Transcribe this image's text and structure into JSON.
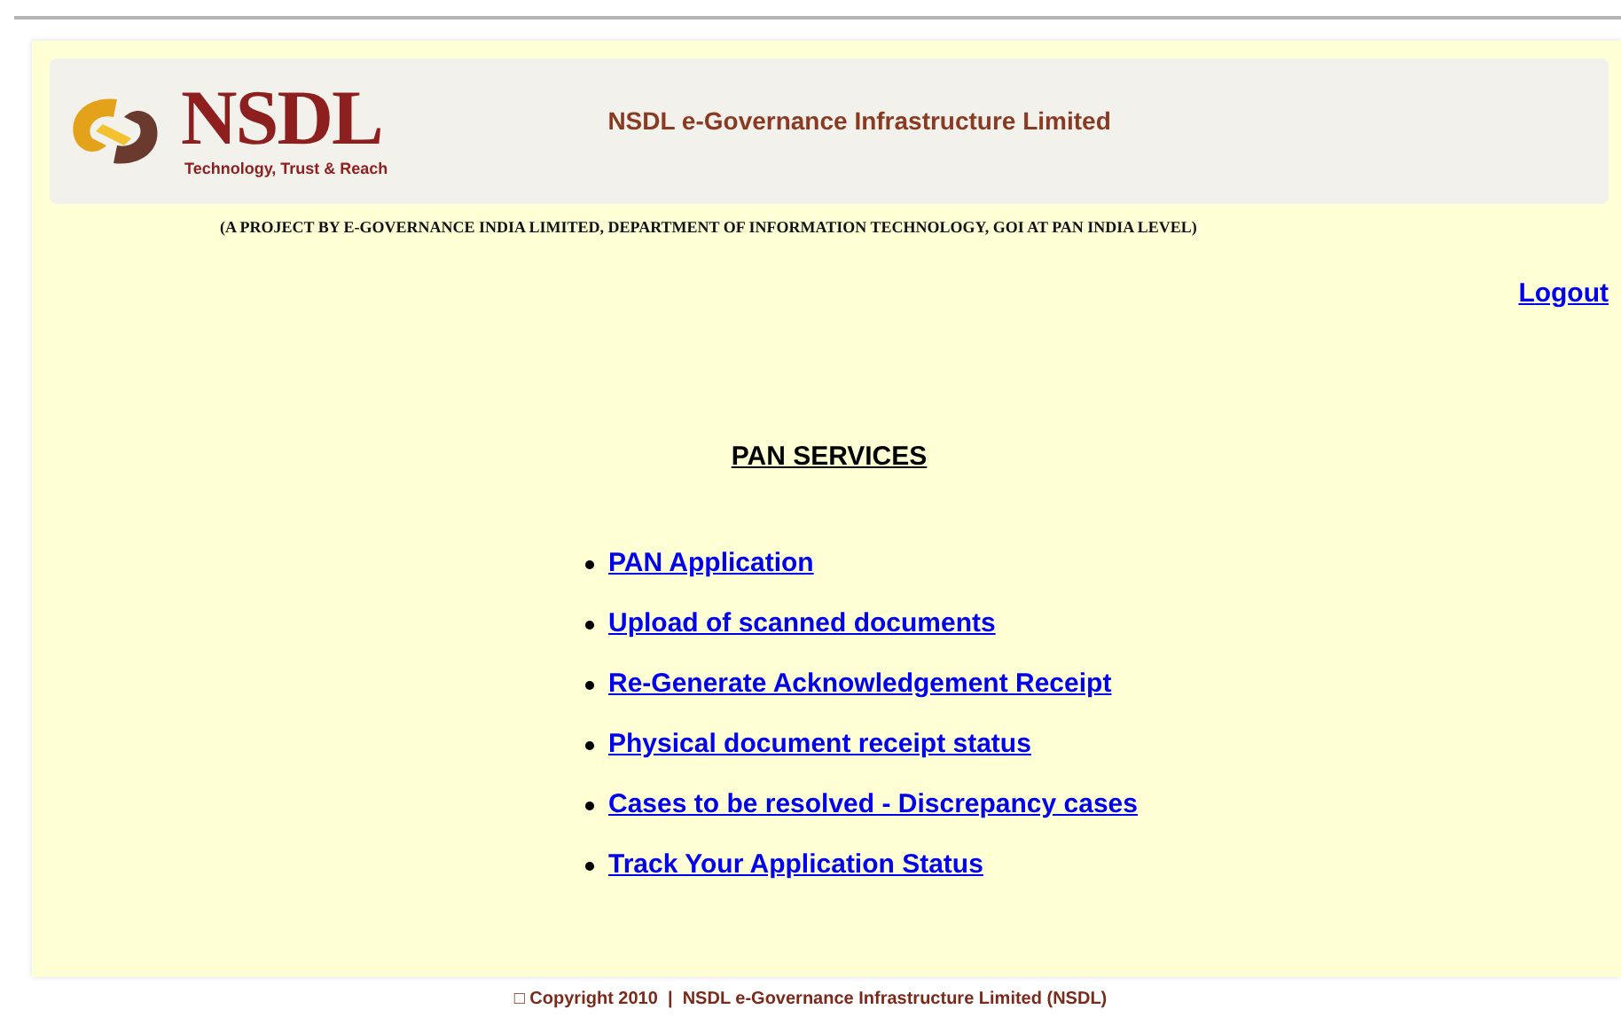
{
  "header": {
    "logo_text": "NSDL",
    "tagline": "Technology, Trust & Reach",
    "title": "NSDL e-Governance Infrastructure Limited"
  },
  "project_line": "(A PROJECT BY E-GOVERNANCE INDIA LIMITED, DEPARTMENT OF INFORMATION TECHNOLOGY, GOI AT PAN INDIA LEVEL)",
  "logout": "Logout",
  "section_title": "PAN SERVICES",
  "services": [
    "PAN Application",
    "Upload of scanned documents",
    "Re-Generate Acknowledgement Receipt",
    "Physical document receipt status",
    "Cases to be resolved - Discrepancy cases",
    "Track Your Application Status"
  ],
  "footer": "□ Copyright 2010  |  NSDL e-Governance Infrastructure Limited (NSDL)"
}
